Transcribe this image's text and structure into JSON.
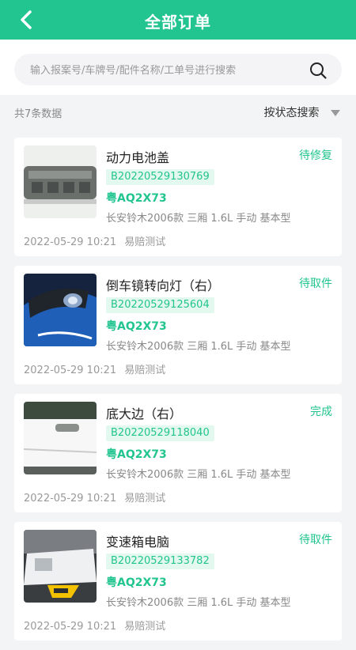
{
  "header": {
    "title": "全部订单",
    "back_icon": "chevron-left-icon"
  },
  "search": {
    "placeholder": "输入报案号/车牌号/配件名称/工单号进行搜索",
    "value": "",
    "icon": "search-icon"
  },
  "summary": {
    "count_text": "共7条数据",
    "filter_label": "按状态搜索",
    "filter_icon": "caret-down-icon"
  },
  "colors": {
    "primary": "#22c48f",
    "tag_bg": "#e3f8ef",
    "page_bg": "#f3f4f6"
  },
  "orders": [
    {
      "part": "动力电池盖",
      "status": "待修复",
      "case_no": "B20220529130769",
      "plate": "粤AQ2X73",
      "vehicle": "长安铃木2006款 三厢 1.6L 手动 基本型",
      "date": "2022-05-29 10:21",
      "user": "易赔测试"
    },
    {
      "part": "倒车镜转向灯（右）",
      "status": "待取件",
      "case_no": "B20220529125604",
      "plate": "粤AQ2X73",
      "vehicle": "长安铃木2006款 三厢 1.6L 手动 基本型",
      "date": "2022-05-29 10:21",
      "user": "易赔测试"
    },
    {
      "part": "底大边（右）",
      "status": "完成",
      "case_no": "B20220529118040",
      "plate": "粤AQ2X73",
      "vehicle": "长安铃木2006款 三厢 1.6L 手动 基本型",
      "date": "2022-05-29 10:21",
      "user": "易赔测试"
    },
    {
      "part": "变速箱电脑",
      "status": "待取件",
      "case_no": "B20220529133782",
      "plate": "粤AQ2X73",
      "vehicle": "长安铃木2006款 三厢 1.6L 手动 基本型",
      "date": "2022-05-29 10:21",
      "user": "易赔测试"
    }
  ]
}
